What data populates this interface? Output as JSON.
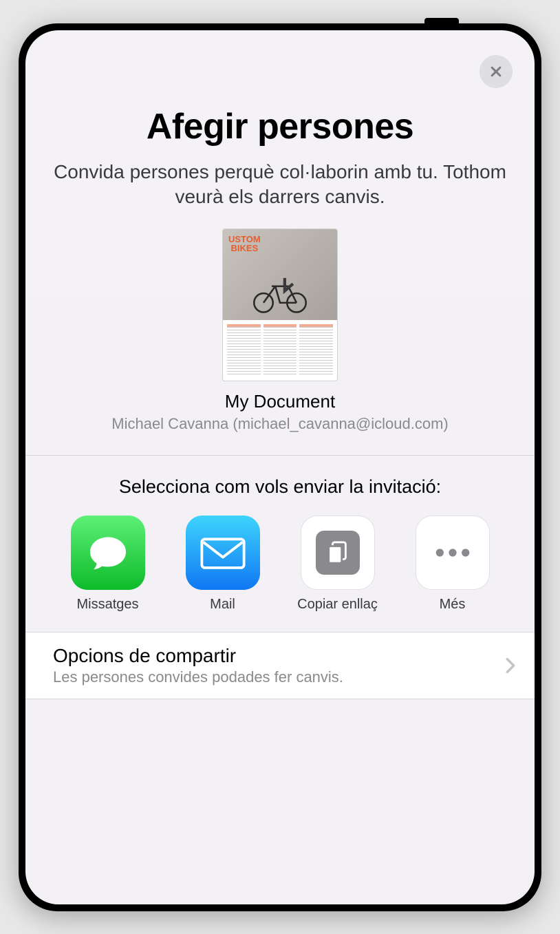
{
  "title": "Afegir persones",
  "subtitle": "Convida persones perquè col·laborin amb tu. Tothom veurà els darrers canvis.",
  "document": {
    "name": "My Document",
    "owner": "Michael Cavanna (michael_cavanna@icloud.com)",
    "preview_heading": "USTOM\nBIKES"
  },
  "share": {
    "prompt": "Selecciona com vols enviar la invitació:",
    "methods": [
      {
        "label": "Missatges",
        "icon": "messages-icon"
      },
      {
        "label": "Mail",
        "icon": "mail-icon"
      },
      {
        "label": "Copiar enllaç",
        "icon": "copy-link-icon"
      },
      {
        "label": "Més",
        "icon": "more-icon"
      }
    ]
  },
  "options": {
    "title": "Opcions de compartir",
    "subtitle": "Les persones convides podades fer canvis."
  }
}
